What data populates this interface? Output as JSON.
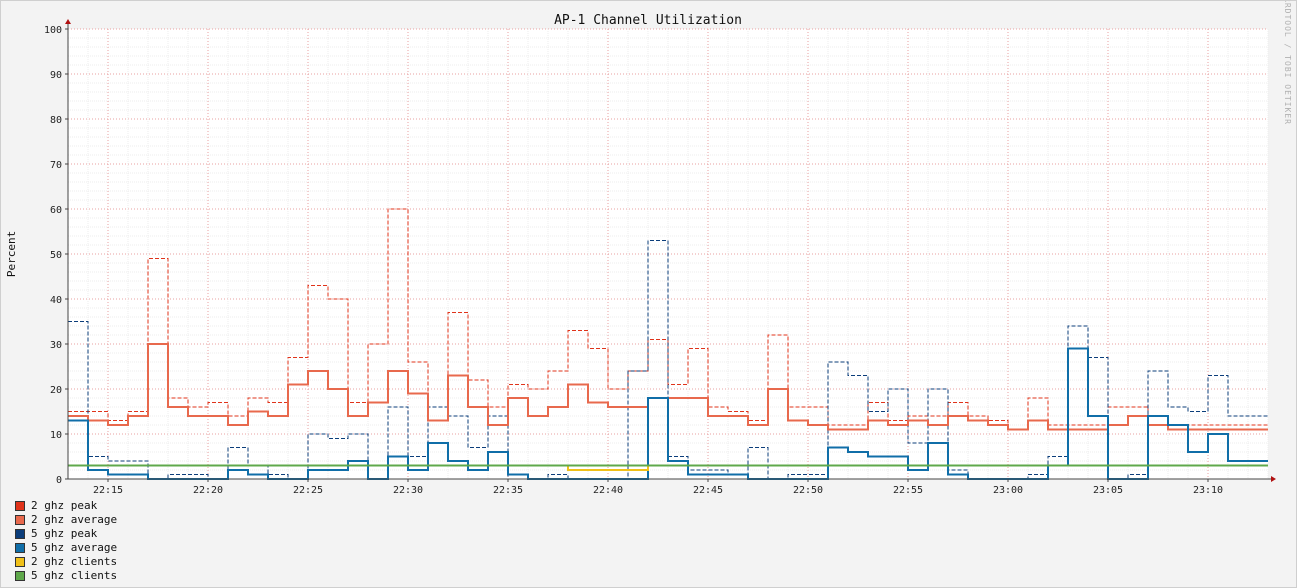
{
  "chart_data": {
    "type": "line",
    "title": "AP-1 Channel Utilization",
    "ylabel": "Percent",
    "xlabel": "",
    "watermark": "RRDTOOL / TOBI OETIKER",
    "ylim": [
      0,
      100
    ],
    "yticks": [
      0,
      10,
      20,
      30,
      40,
      50,
      60,
      70,
      80,
      90,
      100
    ],
    "xlim": [
      "22:13",
      "23:13"
    ],
    "xticks": [
      "22:15",
      "22:20",
      "22:25",
      "22:30",
      "22:35",
      "22:40",
      "22:45",
      "22:50",
      "22:55",
      "23:00",
      "23:05",
      "23:10"
    ],
    "step_minutes": 1,
    "start_time": "22:13",
    "grid": true,
    "legend_position": "bottom-left",
    "series": [
      {
        "name": "2 ghz peak",
        "color": "#e0331a",
        "style": "dashed",
        "values": [
          15,
          15,
          13,
          15,
          49,
          18,
          16,
          17,
          14,
          18,
          17,
          27,
          43,
          40,
          17,
          30,
          60,
          26,
          16,
          37,
          22,
          16,
          21,
          20,
          24,
          33,
          29,
          20,
          24,
          31,
          21,
          29,
          16,
          15,
          13,
          32,
          16,
          16,
          12,
          12,
          17,
          13,
          14,
          14,
          17,
          14,
          13,
          11,
          18,
          12,
          12,
          12,
          16,
          16,
          12,
          12,
          12,
          12,
          12,
          12
        ]
      },
      {
        "name": "2 ghz average",
        "color": "#e8694d",
        "style": "solid",
        "values": [
          14,
          13,
          12,
          14,
          30,
          16,
          14,
          14,
          12,
          15,
          14,
          21,
          24,
          20,
          14,
          17,
          24,
          19,
          13,
          23,
          16,
          12,
          18,
          14,
          16,
          21,
          17,
          16,
          16,
          18,
          18,
          18,
          14,
          14,
          12,
          20,
          13,
          12,
          11,
          11,
          13,
          12,
          13,
          12,
          14,
          13,
          12,
          11,
          13,
          11,
          11,
          11,
          12,
          14,
          12,
          11,
          11,
          11,
          11,
          11
        ]
      },
      {
        "name": "5 ghz peak",
        "color": "#0b3d7a",
        "style": "dashed",
        "values": [
          35,
          5,
          4,
          4,
          0,
          1,
          1,
          0,
          7,
          3,
          1,
          0,
          10,
          9,
          10,
          0,
          16,
          5,
          16,
          14,
          7,
          14,
          0,
          0,
          1,
          0,
          0,
          0,
          24,
          53,
          5,
          2,
          2,
          1,
          7,
          0,
          1,
          1,
          26,
          23,
          15,
          20,
          8,
          20,
          2,
          0,
          0,
          0,
          1,
          5,
          34,
          27,
          0,
          1,
          24,
          16,
          15,
          23,
          14,
          14
        ]
      },
      {
        "name": "5 ghz average",
        "color": "#106ea8",
        "style": "solid",
        "values": [
          13,
          2,
          1,
          1,
          0,
          0,
          0,
          0,
          2,
          1,
          0,
          0,
          2,
          2,
          4,
          0,
          5,
          2,
          8,
          4,
          2,
          6,
          1,
          0,
          0,
          0,
          0,
          0,
          0,
          18,
          4,
          1,
          1,
          1,
          0,
          0,
          0,
          0,
          7,
          6,
          5,
          5,
          2,
          8,
          1,
          0,
          0,
          0,
          0,
          3,
          29,
          14,
          0,
          0,
          14,
          12,
          6,
          10,
          4,
          4
        ]
      },
      {
        "name": "2 ghz clients",
        "color": "#f0c018",
        "style": "solid",
        "values": [
          3,
          3,
          3,
          3,
          3,
          3,
          3,
          3,
          3,
          3,
          3,
          3,
          3,
          3,
          3,
          3,
          3,
          3,
          3,
          3,
          3,
          3,
          3,
          3,
          3,
          2,
          2,
          2,
          2,
          3,
          3,
          3,
          3,
          3,
          3,
          3,
          3,
          3,
          3,
          3,
          3,
          3,
          3,
          3,
          3,
          3,
          3,
          3,
          3,
          3,
          3,
          3,
          3,
          3,
          3,
          3,
          3,
          3,
          3,
          3
        ]
      },
      {
        "name": "5 ghz clients",
        "color": "#5fa84b",
        "style": "solid",
        "values": [
          3,
          3,
          3,
          3,
          3,
          3,
          3,
          3,
          3,
          3,
          3,
          3,
          3,
          3,
          3,
          3,
          3,
          3,
          3,
          3,
          3,
          3,
          3,
          3,
          3,
          3,
          3,
          3,
          3,
          3,
          3,
          3,
          3,
          3,
          3,
          3,
          3,
          3,
          3,
          3,
          3,
          3,
          3,
          3,
          3,
          3,
          3,
          3,
          3,
          3,
          3,
          3,
          3,
          3,
          3,
          3,
          3,
          3,
          3,
          3
        ]
      }
    ]
  }
}
